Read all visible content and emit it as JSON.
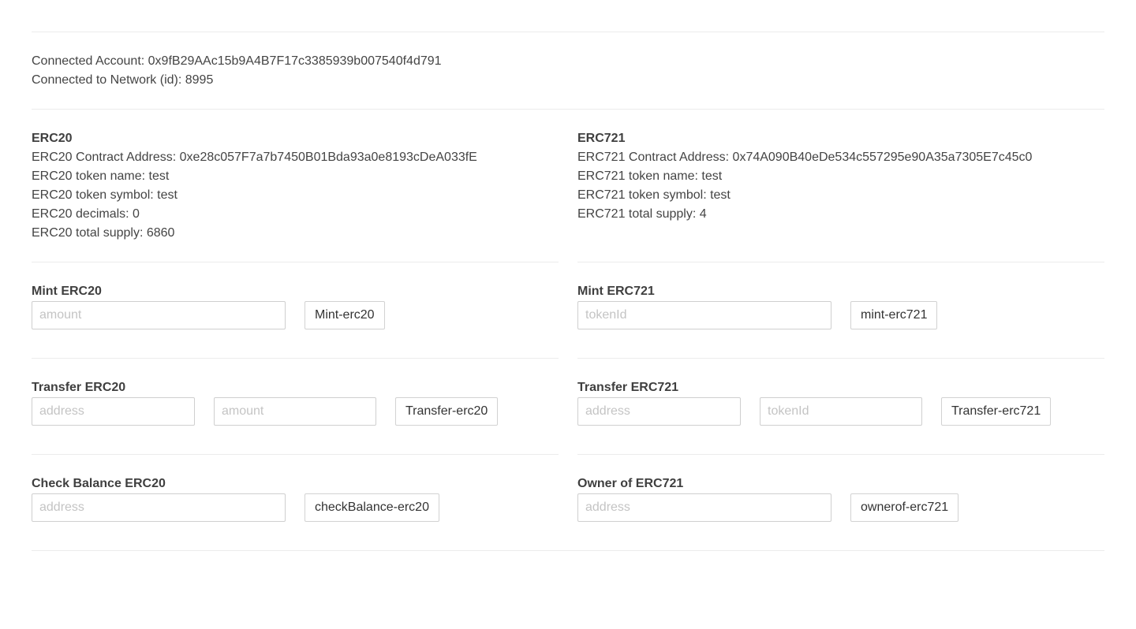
{
  "connection": {
    "account_label": "Connected Account: 0x9fB29AAc15b9A4B7F17c3385939b007540f4d791",
    "network_label": "Connected to Network (id): 8995"
  },
  "erc20_info": {
    "title": "ERC20",
    "contract_address": "ERC20 Contract Address: 0xe28c057F7a7b7450B01Bda93a0e8193cDeA033fE",
    "token_name": "ERC20 token name: test",
    "token_symbol": "ERC20 token symbol: test",
    "decimals": "ERC20 decimals: 0",
    "total_supply": "ERC20 total supply: 6860"
  },
  "erc721_info": {
    "title": "ERC721",
    "contract_address": "ERC721 Contract Address: 0x74A090B40eDe534c557295e90A35a7305E7c45c0",
    "token_name": "ERC721 token name: test",
    "token_symbol": "ERC721 token symbol: test",
    "total_supply": "ERC721 total supply: 4"
  },
  "mint_erc20": {
    "title": "Mint ERC20",
    "amount_placeholder": "amount",
    "button_label": "Mint-erc20"
  },
  "mint_erc721": {
    "title": "Mint ERC721",
    "tokenid_placeholder": "tokenId",
    "button_label": "mint-erc721"
  },
  "transfer_erc20": {
    "title": "Transfer ERC20",
    "address_placeholder": "address",
    "amount_placeholder": "amount",
    "button_label": "Transfer-erc20"
  },
  "transfer_erc721": {
    "title": "Transfer ERC721",
    "address_placeholder": "address",
    "tokenid_placeholder": "tokenId",
    "button_label": "Transfer-erc721"
  },
  "check_balance_erc20": {
    "title": "Check Balance ERC20",
    "address_placeholder": "address",
    "button_label": "checkBalance-erc20"
  },
  "owner_of_erc721": {
    "title": "Owner of ERC721",
    "address_placeholder": "address",
    "button_label": "ownerof-erc721"
  }
}
